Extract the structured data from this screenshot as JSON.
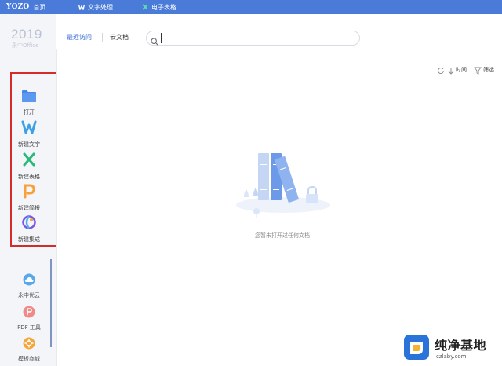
{
  "topbar": {
    "logo": "YOZO",
    "home_label": "首页",
    "tabs": [
      {
        "label": "文字处理",
        "icon": "word-w-icon"
      },
      {
        "label": "电子表格",
        "icon": "sheet-x-icon"
      }
    ]
  },
  "sidebar": {
    "year": "2019",
    "brand": "永中Office",
    "actions": [
      {
        "label": "打开",
        "icon": "folder-icon",
        "color": "#4a87ea"
      },
      {
        "label": "新建文字",
        "icon": "word-w-icon",
        "color": "#3ba0e4"
      },
      {
        "label": "新建表格",
        "icon": "sheet-x-icon",
        "color": "#28b97b"
      },
      {
        "label": "新建简报",
        "icon": "presentation-p-icon",
        "color": "#f7a13b"
      },
      {
        "label": "新建集成",
        "icon": "integration-icon",
        "color": "#7a56e8"
      }
    ],
    "bottom": [
      {
        "label": "永中优云",
        "icon": "cloud-icon",
        "color": "#56a7ec"
      },
      {
        "label": "PDF 工具",
        "icon": "pdf-icon",
        "color": "#f08a8a"
      },
      {
        "label": "模板商城",
        "icon": "template-icon",
        "color": "#f3a63b"
      }
    ]
  },
  "nav": {
    "recent": "最近访问",
    "cloud": "云文档",
    "search_value": ""
  },
  "toolbar": {
    "sort_label": "时间",
    "filter_label": "筛选"
  },
  "empty_state": {
    "message": "您暂未打开过任何文档!"
  },
  "watermark": {
    "title": "纯净基地",
    "url": "czlaby.com"
  },
  "colors": {
    "topbar": "#4a7bd8",
    "accent": "#3d6fd8",
    "highlight_box": "#d42b2b"
  }
}
